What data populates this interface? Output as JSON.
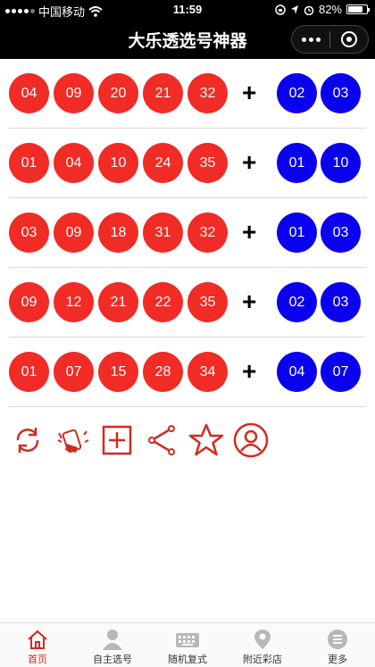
{
  "status": {
    "carrier": "中国移动",
    "time": "11:59",
    "battery": "82%",
    "battery_level": 0.82
  },
  "header": {
    "title": "大乐透选号神器"
  },
  "tickets": [
    {
      "front": [
        "04",
        "09",
        "20",
        "21",
        "32"
      ],
      "back": [
        "02",
        "03"
      ]
    },
    {
      "front": [
        "01",
        "04",
        "10",
        "24",
        "35"
      ],
      "back": [
        "01",
        "10"
      ]
    },
    {
      "front": [
        "03",
        "09",
        "18",
        "31",
        "32"
      ],
      "back": [
        "01",
        "03"
      ]
    },
    {
      "front": [
        "09",
        "12",
        "21",
        "22",
        "35"
      ],
      "back": [
        "02",
        "03"
      ]
    },
    {
      "front": [
        "01",
        "07",
        "15",
        "28",
        "34"
      ],
      "back": [
        "04",
        "07"
      ]
    }
  ],
  "separator": "+",
  "toolbar_icons": [
    "refresh-icon",
    "shake-icon",
    "add-icon",
    "share-icon",
    "star-icon",
    "user-icon"
  ],
  "tabs": [
    {
      "label": "首页",
      "icon": "home-icon",
      "active": true
    },
    {
      "label": "自主选号",
      "icon": "person-icon",
      "active": false
    },
    {
      "label": "随机复式",
      "icon": "keyboard-icon",
      "active": false
    },
    {
      "label": "附近彩店",
      "icon": "location-icon",
      "active": false
    },
    {
      "label": "更多",
      "icon": "menu-icon",
      "active": false
    }
  ],
  "colors": {
    "red_ball": "#f12b25",
    "blue_ball": "#0a00ee",
    "accent": "#d32a20",
    "header_bg": "#000000"
  }
}
